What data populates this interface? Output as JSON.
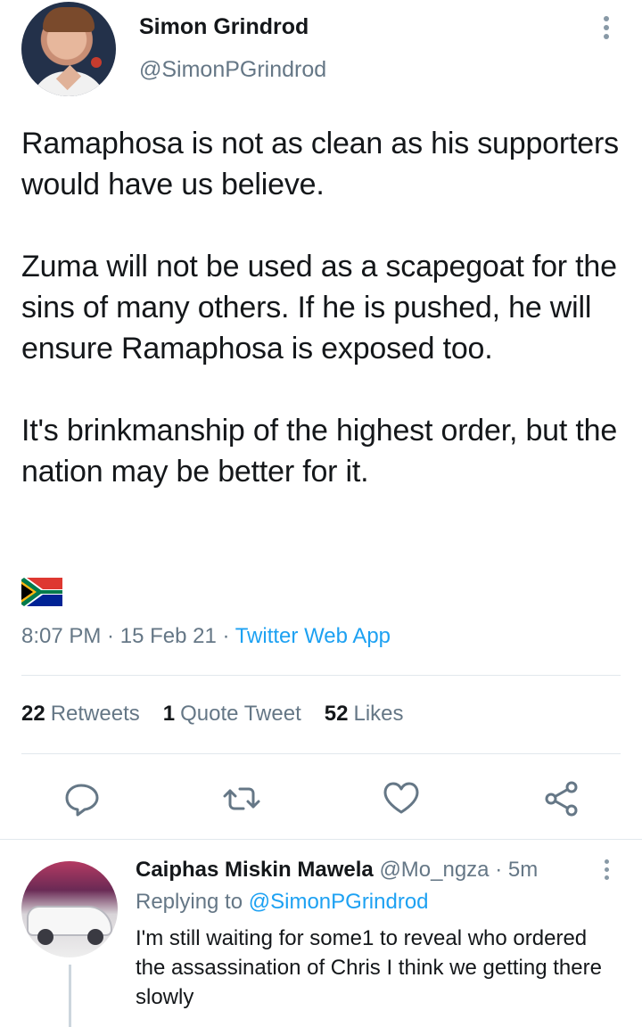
{
  "tweet": {
    "author_name": "Simon Grindrod",
    "author_handle": "@SimonPGrindrod",
    "body": "Ramaphosa is not as clean as his supporters would have us believe.\n\nZuma will not be used as a scapegoat for the sins of many others. If he is pushed, he will ensure Ramaphosa is exposed too.\n\nIt's brinkmanship of the highest order, but the nation may be better for it.",
    "flag_icon": "south-africa-flag-emoji",
    "time": "8:07 PM",
    "date": "15 Feb 21",
    "source": "Twitter Web App",
    "separator": " · "
  },
  "stats": {
    "retweets_count": "22",
    "retweets_label": "Retweets",
    "quotes_count": "1",
    "quotes_label": "Quote Tweet",
    "likes_count": "52",
    "likes_label": "Likes"
  },
  "actions": [
    "reply-icon",
    "retweet-icon",
    "like-icon",
    "share-icon"
  ],
  "reply": {
    "author_name": "Caiphas Miskin Mawela",
    "author_handle": "@Mo_ngza",
    "time": "5m",
    "replying_prefix": "Replying to",
    "replying_to": "@SimonPGrindrod",
    "body": "I'm still waiting for some1 to reveal  who ordered the assassination of Chris I think we getting there slowly"
  },
  "colors": {
    "accent": "#1da1f2",
    "secondary_text": "#657786",
    "primary_text": "#14171a",
    "divider": "#e1e8ed"
  }
}
